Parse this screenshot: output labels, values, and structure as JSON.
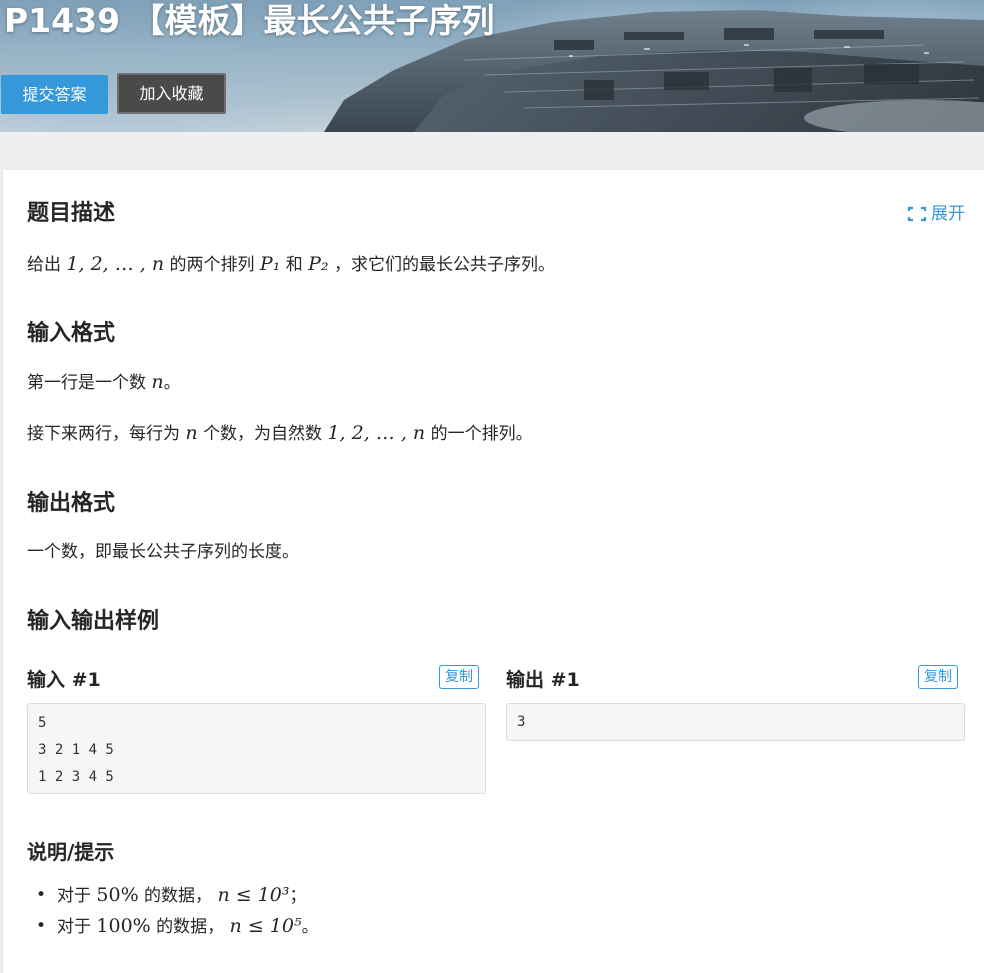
{
  "header": {
    "title": "P1439 【模板】最长公共子序列",
    "submit_label": "提交答案",
    "favorite_label": "加入收藏"
  },
  "description": {
    "heading": "题目描述",
    "expand_label": "展开",
    "text_prefix": "给出",
    "seq": "1, 2, … , n",
    "text_mid": "的两个排列",
    "p1": "P₁",
    "and": "和",
    "p2": "P₂",
    "text_suffix": "，求它们的最长公共子序列。"
  },
  "input_format": {
    "heading": "输入格式",
    "line1_prefix": "第一行是一个数",
    "line1_var": "n",
    "line1_suffix": "。",
    "line2_prefix": "接下来两行，每行为",
    "line2_var": "n",
    "line2_mid": "个数，为自然数",
    "line2_seq": "1, 2, … , n",
    "line2_suffix": "的一个排列。"
  },
  "output_format": {
    "heading": "输出格式",
    "text": "一个数，即最长公共子序列的长度。"
  },
  "samples": {
    "heading": "输入输出样例",
    "input_title": "输入 #1",
    "output_title": "输出 #1",
    "copy_label": "复制",
    "input_lines": [
      "5",
      "3 2 1 4 5",
      "1 2 3 4 5"
    ],
    "output_lines": [
      "3"
    ]
  },
  "hint": {
    "heading": "说明/提示",
    "items": [
      {
        "prefix": "对于",
        "percent": "50%",
        "mid": "的数据，",
        "cond": "n ≤ 10³",
        "end": "；"
      },
      {
        "prefix": "对于",
        "percent": "100%",
        "mid": "的数据，",
        "cond": "n ≤ 10⁵",
        "end": "。"
      }
    ]
  },
  "colors": {
    "accent": "#3498db",
    "fav_button": "#4a4a4a",
    "page_background": "#efefef"
  }
}
